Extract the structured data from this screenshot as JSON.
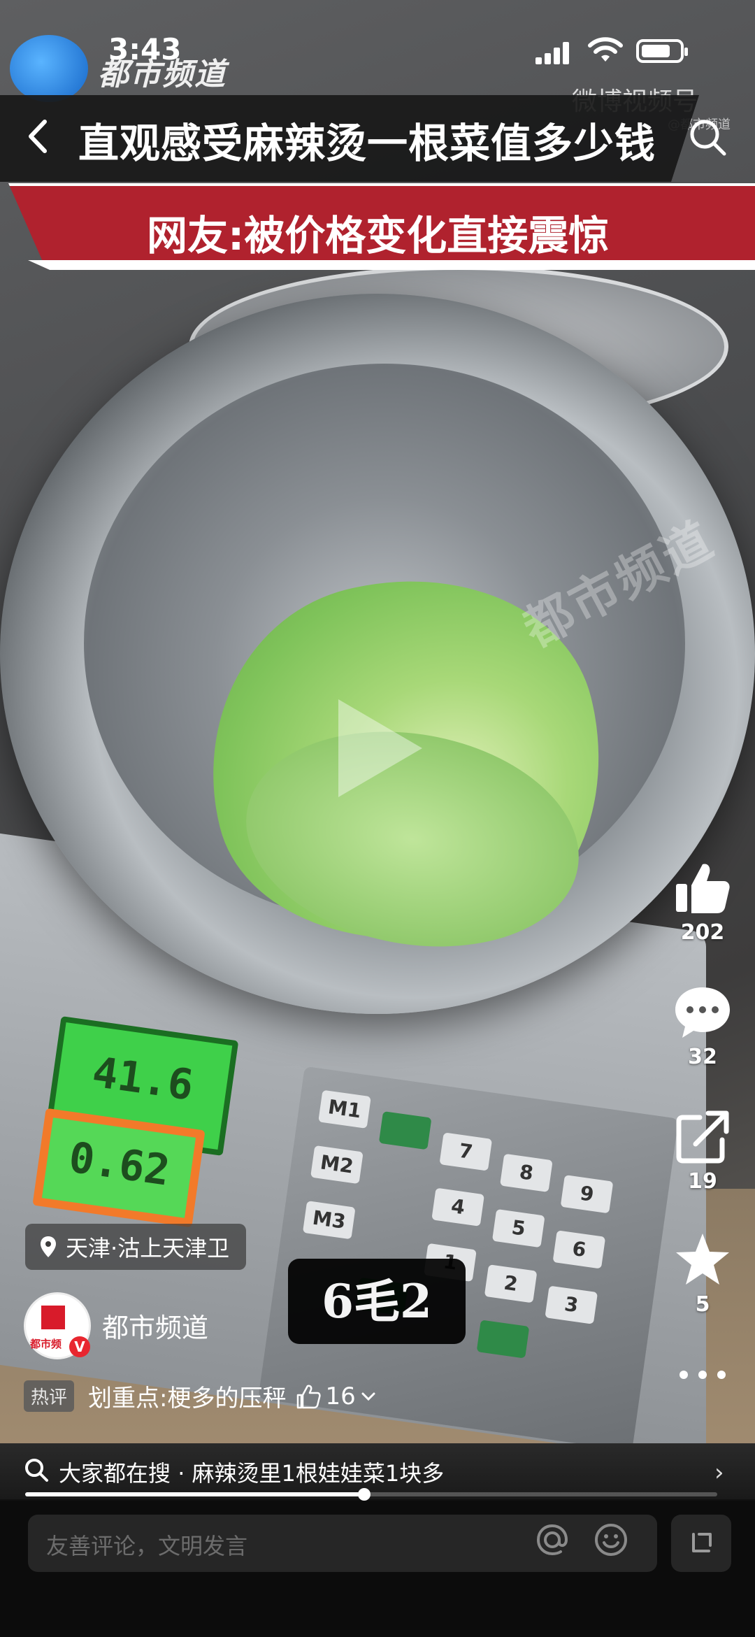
{
  "status_bar": {
    "time": "3:43"
  },
  "channel": {
    "logo_text": "都市频道",
    "watermark": "都市频道",
    "source": "微博视频号",
    "source_sub": "@都市频道"
  },
  "headline": {
    "line1": "直观感受麻辣烫一根菜值多少钱",
    "line2": "网友:被价格变化直接震惊"
  },
  "scene": {
    "weight_display": "41.6",
    "price_display": "0.62",
    "keys": [
      "M1",
      "7",
      "8",
      "9",
      "M2",
      "4",
      "5",
      "6",
      "M3",
      "1",
      "2",
      "3"
    ]
  },
  "location": "天津·沽上天津卫",
  "subtitle": "6毛2",
  "author": {
    "name": "都市频道",
    "avatar_text": "都市频",
    "verified": "V"
  },
  "hot_comment": {
    "tag": "热评",
    "text": "划重点:梗多的压秤",
    "likes": "16"
  },
  "actions": {
    "likes": "202",
    "comments": "32",
    "shares": "19",
    "favorites": "5"
  },
  "search_suggestion": {
    "prefix": "大家都在搜",
    "query": "麻辣烫里1根娃娃菜1块多"
  },
  "progress": {
    "fraction": 0.49
  },
  "comment_box": {
    "placeholder": "友善评论，文明发言"
  }
}
